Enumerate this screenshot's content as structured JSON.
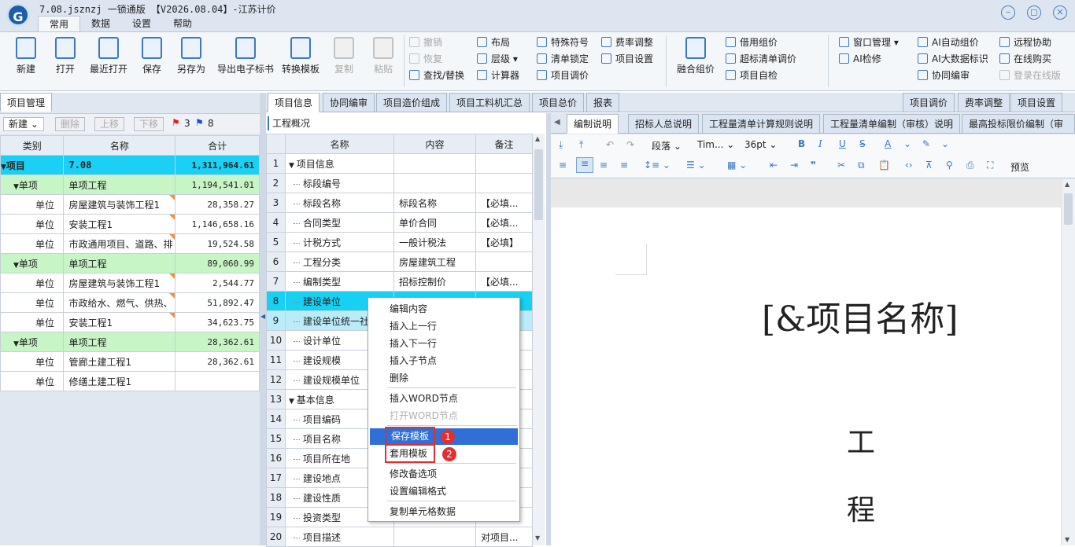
{
  "window": {
    "title": "7.08.jsznzj 一锁通版 【V2026.08.04】-江苏计价"
  },
  "menu_tabs": [
    "常用",
    "数据",
    "设置",
    "帮助"
  ],
  "ribbon": {
    "big_buttons": [
      "新建",
      "打开",
      "最近打开",
      "保存",
      "另存为",
      "导出电子标书",
      "转换模板",
      "复制",
      "粘贴"
    ],
    "edit": [
      "撤销",
      "恢复",
      "查找/替换"
    ],
    "layout": [
      "布局",
      "层级",
      "计算器"
    ],
    "tools": [
      "特殊符号",
      "清单锁定",
      "项目调价"
    ],
    "rates": [
      "费率调整",
      "项目设置"
    ],
    "merge": "融合组价",
    "pricing": [
      "借用组价",
      "超标清单调价",
      "项目自检"
    ],
    "window": [
      "窗口管理",
      "AI检修"
    ],
    "ai": [
      "AI自动组价",
      "AI大数据标识",
      "协同编审"
    ],
    "remote": [
      "远程协助",
      "在线购买",
      "登录在线版"
    ]
  },
  "left_panel": {
    "tab": "项目管理",
    "toolbar": {
      "new": "新建",
      "delete": "删除",
      "up": "上移",
      "down": "下移",
      "red_flag_count": "3",
      "blue_flag_count": "8"
    },
    "columns": [
      "类别",
      "名称",
      "合计"
    ],
    "rows": [
      {
        "type": "项目",
        "name": "7.08",
        "total": "1,311,964.61"
      },
      {
        "type": "单项",
        "name": "单项工程",
        "total": "1,194,541.01"
      },
      {
        "type": "单位",
        "name": "房屋建筑与装饰工程1",
        "total": "28,358.27"
      },
      {
        "type": "单位",
        "name": "安装工程1",
        "total": "1,146,658.16"
      },
      {
        "type": "单位",
        "name": "市政通用项目、道路、排",
        "total": "19,524.58"
      },
      {
        "type": "单项",
        "name": "单项工程",
        "total": "89,060.99"
      },
      {
        "type": "单位",
        "name": "房屋建筑与装饰工程1",
        "total": "2,544.77"
      },
      {
        "type": "单位",
        "name": "市政给水、燃气、供热、",
        "total": "51,892.47"
      },
      {
        "type": "单位",
        "name": "安装工程1",
        "total": "34,623.75"
      },
      {
        "type": "单项",
        "name": "单项工程",
        "total": "28,362.61"
      },
      {
        "type": "单位",
        "name": "管廊土建工程1",
        "total": "28,362.61"
      },
      {
        "type": "单位",
        "name": "修缮土建工程1",
        "total": ""
      }
    ]
  },
  "mid_tabs": [
    "项目信息",
    "协同编审",
    "项目造价组成",
    "项目工料机汇总",
    "项目总价",
    "报表"
  ],
  "right_top_tabs": [
    "项目调价",
    "费率调整",
    "项目设置"
  ],
  "overview_label": "工程概况",
  "info_columns": [
    "名称",
    "内容",
    "备注"
  ],
  "info_rows": [
    {
      "n": "1",
      "name": "项目信息",
      "content": "",
      "note": ""
    },
    {
      "n": "2",
      "name": "标段编号",
      "content": "",
      "note": ""
    },
    {
      "n": "3",
      "name": "标段名称",
      "content": "标段名称",
      "note": "【必填..."
    },
    {
      "n": "4",
      "name": "合同类型",
      "content": "单价合同",
      "note": "【必填..."
    },
    {
      "n": "5",
      "name": "计税方式",
      "content": "一般计税法",
      "note": "【必填】"
    },
    {
      "n": "6",
      "name": "工程分类",
      "content": "房屋建筑工程",
      "note": ""
    },
    {
      "n": "7",
      "name": "编制类型",
      "content": "招标控制价",
      "note": "【必填..."
    },
    {
      "n": "8",
      "name": "建设单位",
      "content": "",
      "note": ""
    },
    {
      "n": "9",
      "name": "建设单位统一社",
      "content": "",
      "note": ""
    },
    {
      "n": "10",
      "name": "设计单位",
      "content": "",
      "note": ""
    },
    {
      "n": "11",
      "name": "建设规模",
      "content": "",
      "note": ""
    },
    {
      "n": "12",
      "name": "建设规模单位",
      "content": "",
      "note": ""
    },
    {
      "n": "13",
      "name": "基本信息",
      "content": "",
      "note": ""
    },
    {
      "n": "14",
      "name": "项目编码",
      "content": "",
      "note": ""
    },
    {
      "n": "15",
      "name": "项目名称",
      "content": "",
      "note": ""
    },
    {
      "n": "16",
      "name": "项目所在地",
      "content": "",
      "note": ""
    },
    {
      "n": "17",
      "name": "建设地点",
      "content": "",
      "note": ""
    },
    {
      "n": "18",
      "name": "建设性质",
      "content": "",
      "note": ""
    },
    {
      "n": "19",
      "name": "投资类型",
      "content": "",
      "note": ""
    },
    {
      "n": "20",
      "name": "项目描述",
      "content": "",
      "note": "对项目..."
    }
  ],
  "doc_tabs": [
    "编制说明",
    "招标人总说明",
    "工程量清单计算规则说明",
    "工程量清单编制（审核）说明",
    "最高投标限价编制（审"
  ],
  "editor": {
    "paragraph": "段落",
    "font": "Tim...",
    "size": "36pt",
    "preview": "预览"
  },
  "document": {
    "title": "[&项目名称]",
    "char1": "工",
    "char2": "程"
  },
  "context_menu": [
    {
      "label": "编辑内容",
      "enabled": true
    },
    {
      "label": "插入上一行",
      "enabled": true
    },
    {
      "label": "插入下一行",
      "enabled": true
    },
    {
      "label": "插入子节点",
      "enabled": true
    },
    {
      "label": "删除",
      "enabled": true
    },
    {
      "label": "插入WORD节点",
      "enabled": true
    },
    {
      "label": "打开WORD节点",
      "enabled": false
    },
    {
      "label": "保存模板",
      "enabled": true,
      "selected": true
    },
    {
      "label": "套用模板",
      "enabled": true
    },
    {
      "label": "修改备选项",
      "enabled": true
    },
    {
      "label": "设置编辑格式",
      "enabled": true
    },
    {
      "label": "复制单元格数据",
      "enabled": true
    }
  ],
  "annotations": [
    "1",
    "2"
  ],
  "colors": {
    "accent": "#3d78c0",
    "selected_row": "#17d0f2",
    "project_row": "#1ad0f4",
    "single_row": "#c7f5c5",
    "menu_highlight": "#2f6fd6",
    "annotation": "#e03030"
  }
}
